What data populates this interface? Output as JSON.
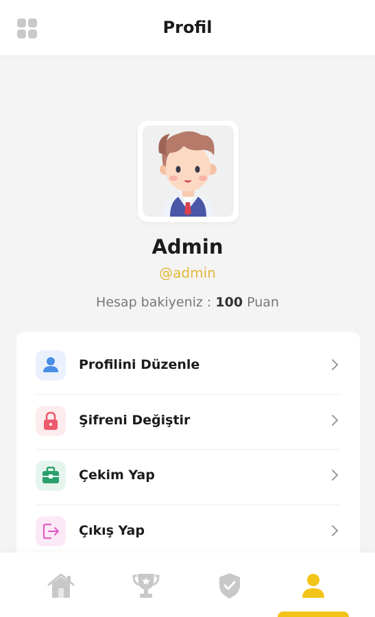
{
  "header": {
    "title": "Profil",
    "menu_icon": "grid-icon"
  },
  "profile": {
    "name": "Admin",
    "username": "@admin",
    "balance_label": "Hesap bakiyeniz :",
    "balance_value": "100",
    "balance_unit": "Puan"
  },
  "menu": {
    "items": [
      {
        "label": "Profilini Düzenle",
        "icon": "user-icon",
        "icon_color": "#4a8de4",
        "bg": "#eaf1fc"
      },
      {
        "label": "Şifreni Değiştir",
        "icon": "lock-icon",
        "icon_color": "#ee5a6e",
        "bg": "#fdecee"
      },
      {
        "label": "Çekim Yap",
        "icon": "briefcase-icon",
        "icon_color": "#2a9f6a",
        "bg": "#e5f5ee"
      },
      {
        "label": "Çıkış Yap",
        "icon": "logout-icon",
        "icon_color": "#e05fc4",
        "bg": "#fce9f7"
      }
    ]
  },
  "tabs": [
    {
      "name": "home-icon",
      "active": false
    },
    {
      "name": "trophy-icon",
      "active": false
    },
    {
      "name": "shield-check-icon",
      "active": false
    },
    {
      "name": "user-icon",
      "active": true
    }
  ],
  "colors": {
    "accent": "#f2c318",
    "handle": "#e2b83a",
    "inactive_icon": "#c8c8c8"
  }
}
